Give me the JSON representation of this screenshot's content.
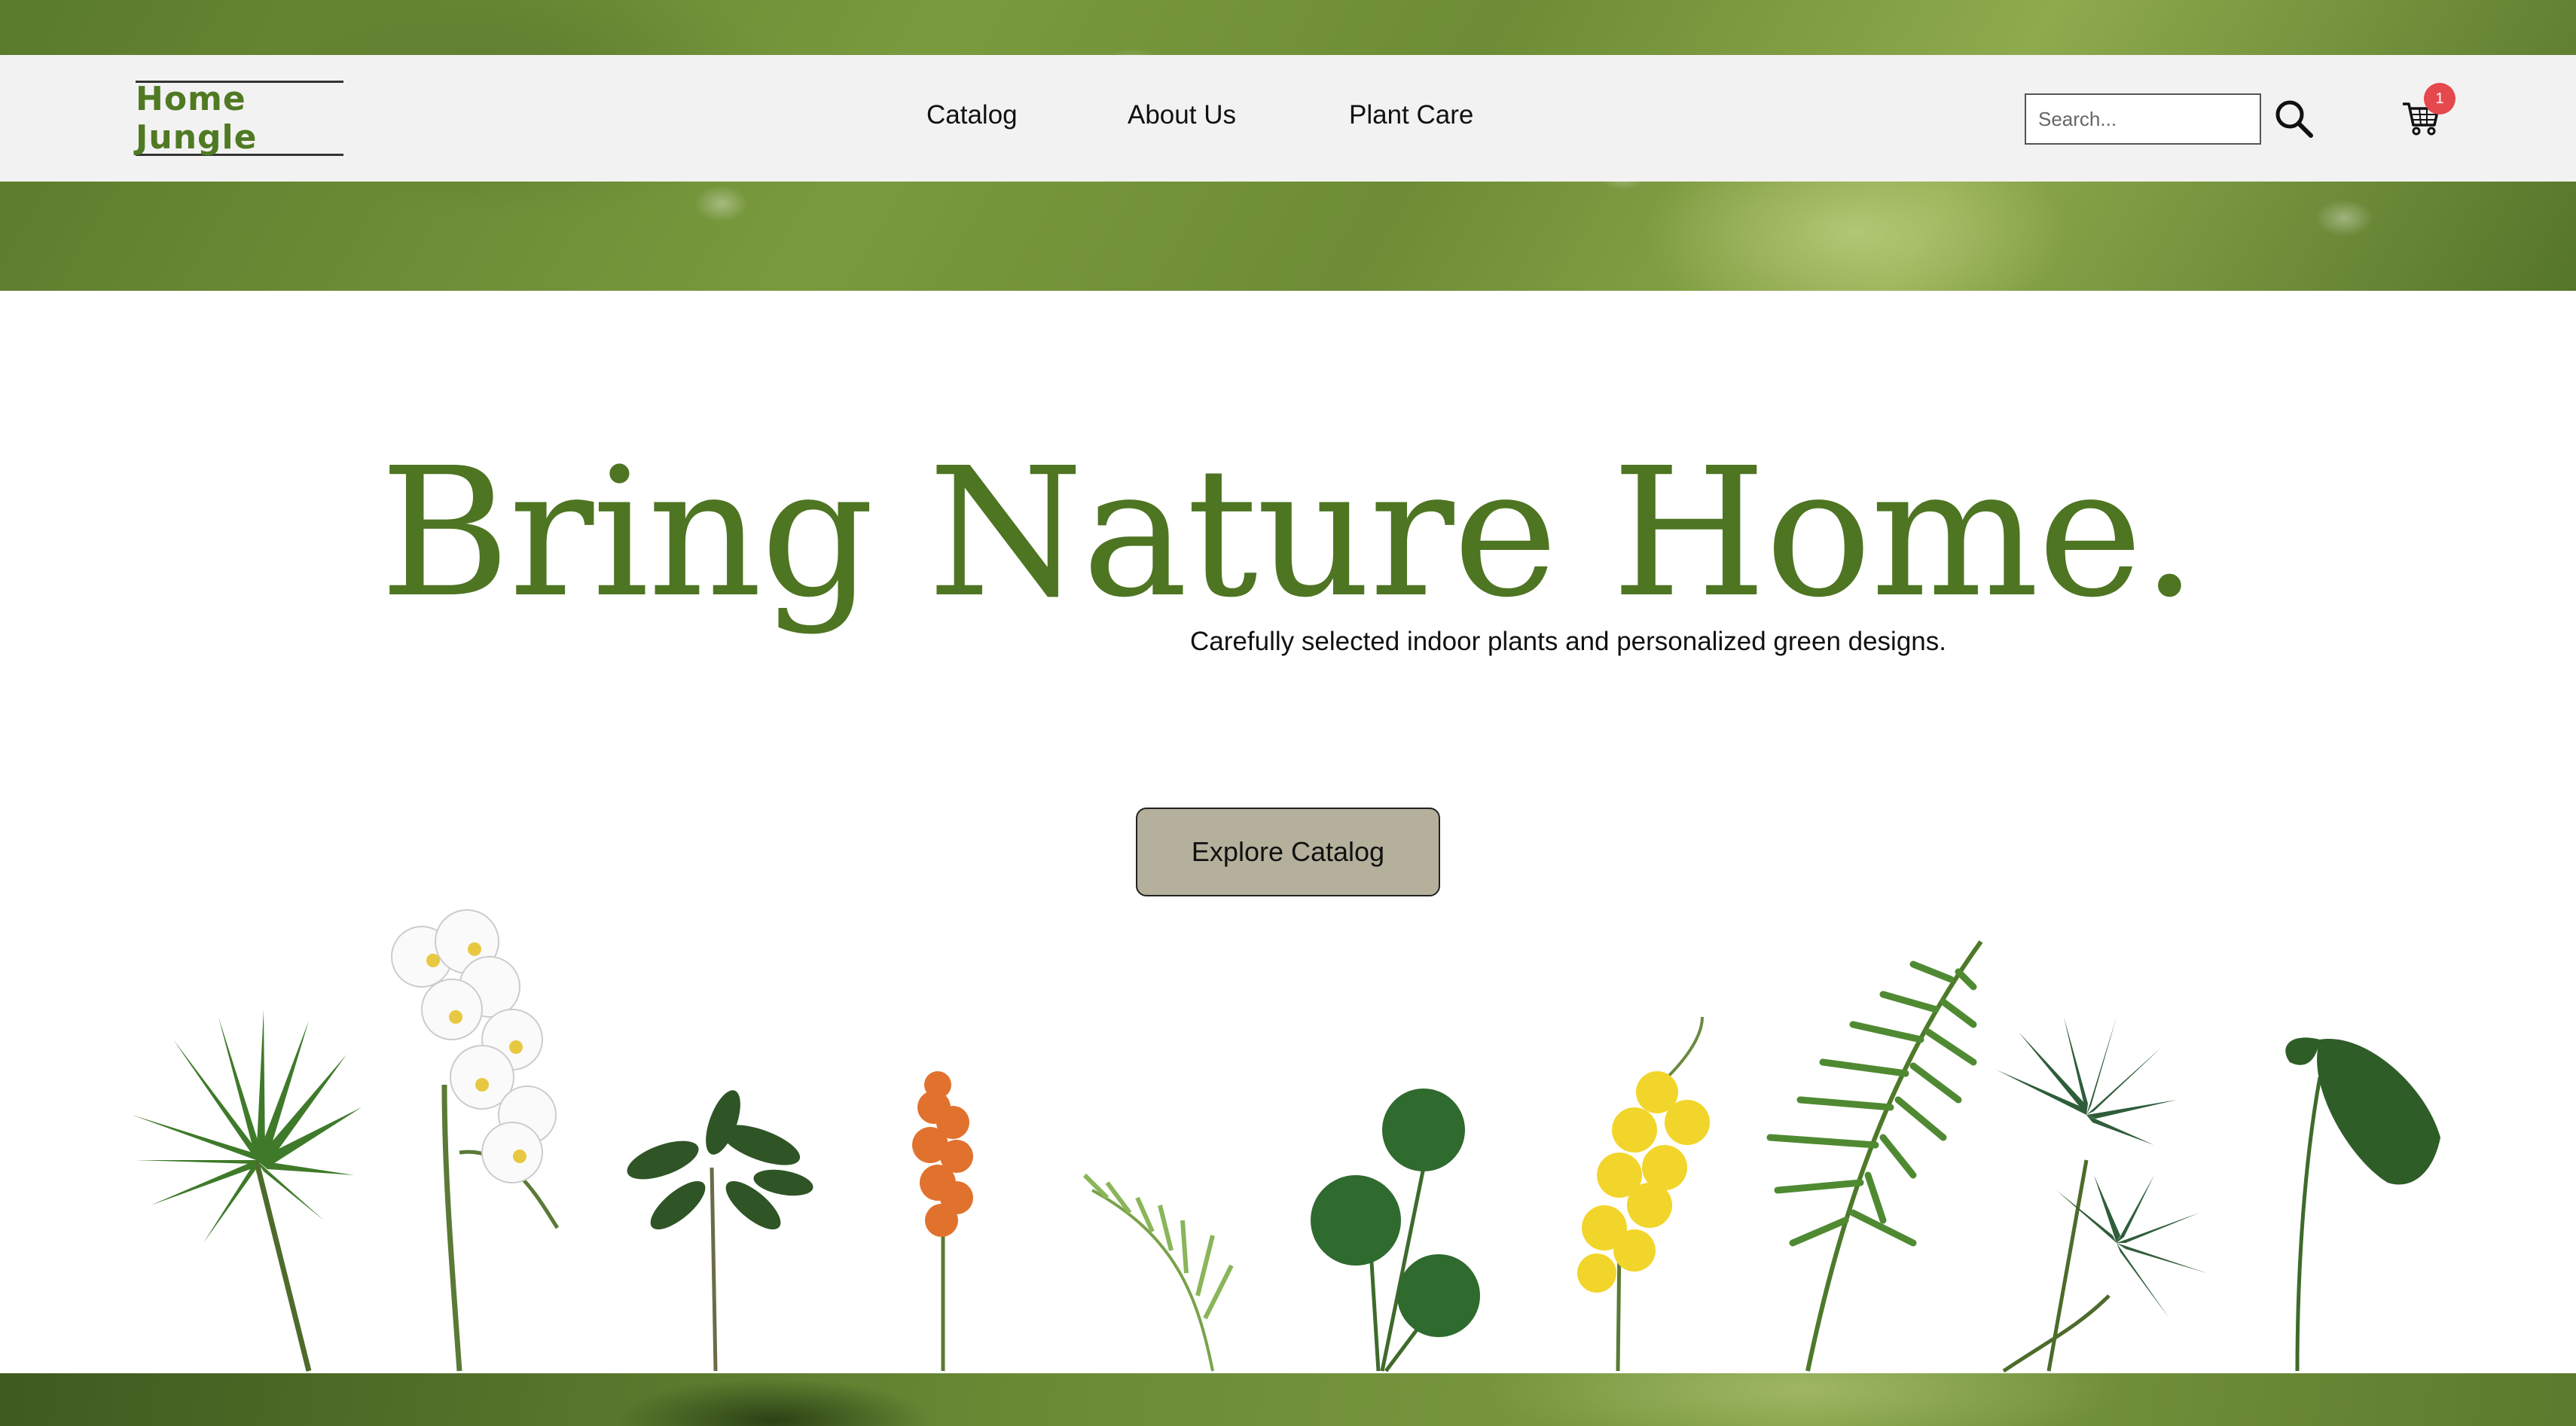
{
  "header": {
    "logo": "Home Jungle",
    "nav": [
      "Catalog",
      "About Us",
      "Plant Care"
    ],
    "search_placeholder": "Search...",
    "cart_count": "1"
  },
  "hero": {
    "title": "Bring Nature Home.",
    "subtitle": "Carefully selected indoor plants and personalized green designs.",
    "cta": "Explore Catalog"
  },
  "plants": [
    "fan-palm",
    "white-orchid",
    "small-tree",
    "orange-orchid",
    "fern-palm",
    "monstera",
    "yellow-orchid",
    "fern",
    "fan-palm-double",
    "philodendron"
  ],
  "colors": {
    "brand_green": "#4e7522",
    "nav_bg": "#f3f2f2",
    "button_bg": "#b4b09b",
    "badge_red": "#e5484d"
  }
}
